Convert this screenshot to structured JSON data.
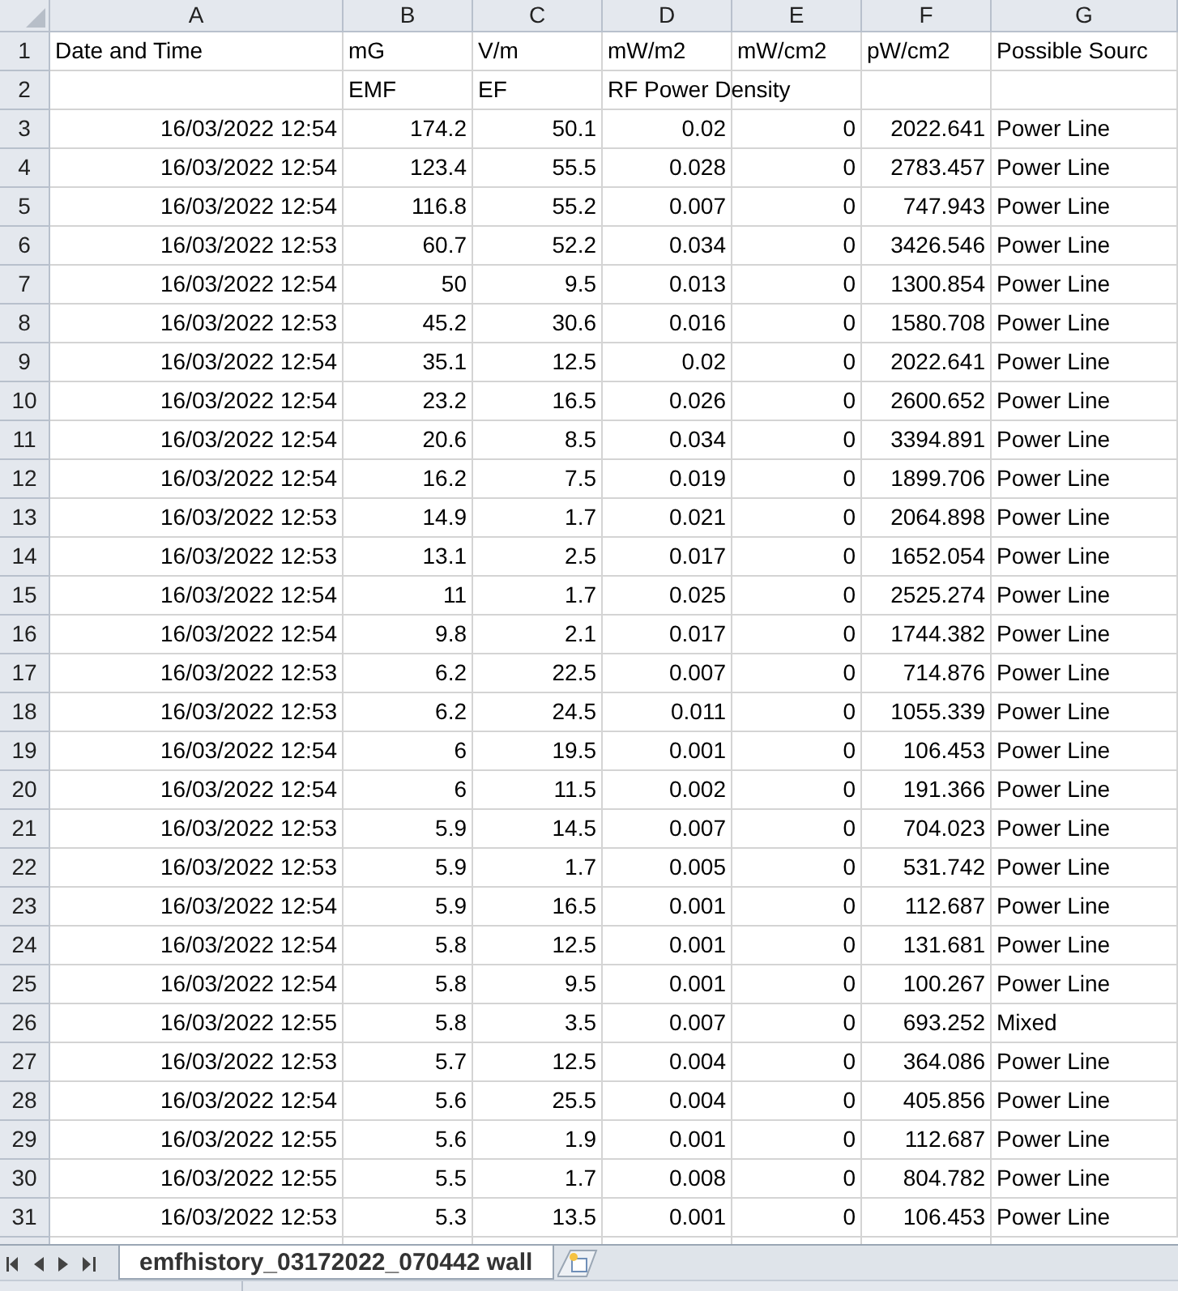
{
  "columns": [
    "A",
    "B",
    "C",
    "D",
    "E",
    "F",
    "G"
  ],
  "rows": [
    {
      "number": "1",
      "kind": "label",
      "cells": {
        "A": "Date and Time",
        "B": "mG",
        "C": "V/m",
        "D": "mW/m2",
        "E": "mW/cm2",
        "F": "pW/cm2",
        "G": "Possible Sourc"
      }
    },
    {
      "number": "2",
      "kind": "label",
      "cells": {
        "B": "EMF",
        "C": "EF",
        "D": "RF Power Density"
      }
    },
    {
      "number": "3",
      "kind": "data",
      "cells": {
        "A": "16/03/2022 12:54",
        "B": "174.2",
        "C": "50.1",
        "D": "0.02",
        "E": "0",
        "F": "2022.641",
        "G": "Power Line"
      }
    },
    {
      "number": "4",
      "kind": "data",
      "cells": {
        "A": "16/03/2022 12:54",
        "B": "123.4",
        "C": "55.5",
        "D": "0.028",
        "E": "0",
        "F": "2783.457",
        "G": "Power Line"
      }
    },
    {
      "number": "5",
      "kind": "data",
      "cells": {
        "A": "16/03/2022 12:54",
        "B": "116.8",
        "C": "55.2",
        "D": "0.007",
        "E": "0",
        "F": "747.943",
        "G": "Power Line"
      }
    },
    {
      "number": "6",
      "kind": "data",
      "cells": {
        "A": "16/03/2022 12:53",
        "B": "60.7",
        "C": "52.2",
        "D": "0.034",
        "E": "0",
        "F": "3426.546",
        "G": "Power Line"
      }
    },
    {
      "number": "7",
      "kind": "data",
      "cells": {
        "A": "16/03/2022 12:54",
        "B": "50",
        "C": "9.5",
        "D": "0.013",
        "E": "0",
        "F": "1300.854",
        "G": "Power Line"
      }
    },
    {
      "number": "8",
      "kind": "data",
      "cells": {
        "A": "16/03/2022 12:53",
        "B": "45.2",
        "C": "30.6",
        "D": "0.016",
        "E": "0",
        "F": "1580.708",
        "G": "Power Line"
      }
    },
    {
      "number": "9",
      "kind": "data",
      "cells": {
        "A": "16/03/2022 12:54",
        "B": "35.1",
        "C": "12.5",
        "D": "0.02",
        "E": "0",
        "F": "2022.641",
        "G": "Power Line"
      }
    },
    {
      "number": "10",
      "kind": "data",
      "cells": {
        "A": "16/03/2022 12:54",
        "B": "23.2",
        "C": "16.5",
        "D": "0.026",
        "E": "0",
        "F": "2600.652",
        "G": "Power Line"
      }
    },
    {
      "number": "11",
      "kind": "data",
      "cells": {
        "A": "16/03/2022 12:54",
        "B": "20.6",
        "C": "8.5",
        "D": "0.034",
        "E": "0",
        "F": "3394.891",
        "G": "Power Line"
      }
    },
    {
      "number": "12",
      "kind": "data",
      "cells": {
        "A": "16/03/2022 12:54",
        "B": "16.2",
        "C": "7.5",
        "D": "0.019",
        "E": "0",
        "F": "1899.706",
        "G": "Power Line"
      }
    },
    {
      "number": "13",
      "kind": "data",
      "cells": {
        "A": "16/03/2022 12:53",
        "B": "14.9",
        "C": "1.7",
        "D": "0.021",
        "E": "0",
        "F": "2064.898",
        "G": "Power Line"
      }
    },
    {
      "number": "14",
      "kind": "data",
      "cells": {
        "A": "16/03/2022 12:53",
        "B": "13.1",
        "C": "2.5",
        "D": "0.017",
        "E": "0",
        "F": "1652.054",
        "G": "Power Line"
      }
    },
    {
      "number": "15",
      "kind": "data",
      "cells": {
        "A": "16/03/2022 12:54",
        "B": "11",
        "C": "1.7",
        "D": "0.025",
        "E": "0",
        "F": "2525.274",
        "G": "Power Line"
      }
    },
    {
      "number": "16",
      "kind": "data",
      "cells": {
        "A": "16/03/2022 12:54",
        "B": "9.8",
        "C": "2.1",
        "D": "0.017",
        "E": "0",
        "F": "1744.382",
        "G": "Power Line"
      }
    },
    {
      "number": "17",
      "kind": "data",
      "cells": {
        "A": "16/03/2022 12:53",
        "B": "6.2",
        "C": "22.5",
        "D": "0.007",
        "E": "0",
        "F": "714.876",
        "G": "Power Line"
      }
    },
    {
      "number": "18",
      "kind": "data",
      "cells": {
        "A": "16/03/2022 12:53",
        "B": "6.2",
        "C": "24.5",
        "D": "0.011",
        "E": "0",
        "F": "1055.339",
        "G": "Power Line"
      }
    },
    {
      "number": "19",
      "kind": "data",
      "cells": {
        "A": "16/03/2022 12:54",
        "B": "6",
        "C": "19.5",
        "D": "0.001",
        "E": "0",
        "F": "106.453",
        "G": "Power Line"
      }
    },
    {
      "number": "20",
      "kind": "data",
      "cells": {
        "A": "16/03/2022 12:54",
        "B": "6",
        "C": "11.5",
        "D": "0.002",
        "E": "0",
        "F": "191.366",
        "G": "Power Line"
      }
    },
    {
      "number": "21",
      "kind": "data",
      "cells": {
        "A": "16/03/2022 12:53",
        "B": "5.9",
        "C": "14.5",
        "D": "0.007",
        "E": "0",
        "F": "704.023",
        "G": "Power Line"
      }
    },
    {
      "number": "22",
      "kind": "data",
      "cells": {
        "A": "16/03/2022 12:53",
        "B": "5.9",
        "C": "1.7",
        "D": "0.005",
        "E": "0",
        "F": "531.742",
        "G": "Power Line"
      }
    },
    {
      "number": "23",
      "kind": "data",
      "cells": {
        "A": "16/03/2022 12:54",
        "B": "5.9",
        "C": "16.5",
        "D": "0.001",
        "E": "0",
        "F": "112.687",
        "G": "Power Line"
      }
    },
    {
      "number": "24",
      "kind": "data",
      "cells": {
        "A": "16/03/2022 12:54",
        "B": "5.8",
        "C": "12.5",
        "D": "0.001",
        "E": "0",
        "F": "131.681",
        "G": "Power Line"
      }
    },
    {
      "number": "25",
      "kind": "data",
      "cells": {
        "A": "16/03/2022 12:54",
        "B": "5.8",
        "C": "9.5",
        "D": "0.001",
        "E": "0",
        "F": "100.267",
        "G": "Power Line"
      }
    },
    {
      "number": "26",
      "kind": "data",
      "cells": {
        "A": "16/03/2022 12:55",
        "B": "5.8",
        "C": "3.5",
        "D": "0.007",
        "E": "0",
        "F": "693.252",
        "G": "Mixed"
      }
    },
    {
      "number": "27",
      "kind": "data",
      "cells": {
        "A": "16/03/2022 12:53",
        "B": "5.7",
        "C": "12.5",
        "D": "0.004",
        "E": "0",
        "F": "364.086",
        "G": "Power Line"
      }
    },
    {
      "number": "28",
      "kind": "data",
      "cells": {
        "A": "16/03/2022 12:54",
        "B": "5.6",
        "C": "25.5",
        "D": "0.004",
        "E": "0",
        "F": "405.856",
        "G": "Power Line"
      }
    },
    {
      "number": "29",
      "kind": "data",
      "cells": {
        "A": "16/03/2022 12:55",
        "B": "5.6",
        "C": "1.9",
        "D": "0.001",
        "E": "0",
        "F": "112.687",
        "G": "Power Line"
      }
    },
    {
      "number": "30",
      "kind": "data",
      "cells": {
        "A": "16/03/2022 12:55",
        "B": "5.5",
        "C": "1.7",
        "D": "0.008",
        "E": "0",
        "F": "804.782",
        "G": "Power Line"
      }
    },
    {
      "number": "31",
      "kind": "data",
      "cells": {
        "A": "16/03/2022 12:53",
        "B": "5.3",
        "C": "13.5",
        "D": "0.001",
        "E": "0",
        "F": "106.453",
        "G": "Power Line"
      }
    }
  ],
  "sheet_tabs": [
    {
      "label": "emfhistory_03172022_070442 wall",
      "selected": true
    }
  ]
}
